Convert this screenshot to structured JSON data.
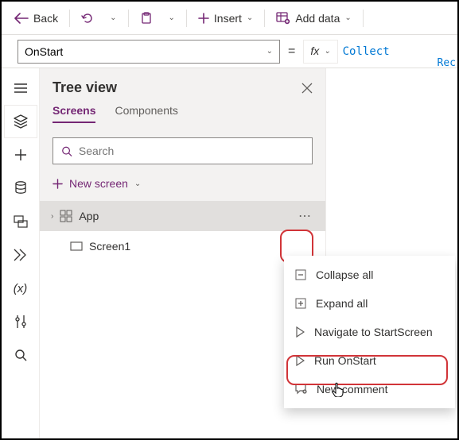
{
  "topbar": {
    "back": "Back",
    "insert": "Insert",
    "add_data": "Add data"
  },
  "formula": {
    "property": "OnStart",
    "fx": "fx",
    "text1": "Collect",
    "text2": "Rec"
  },
  "rail": {},
  "tree": {
    "title": "Tree view",
    "tabs": {
      "screens": "Screens",
      "components": "Components"
    },
    "search_placeholder": "Search",
    "new_screen": "New screen",
    "nodes": {
      "app": "App",
      "screen1": "Screen1"
    }
  },
  "menu": {
    "collapse": "Collapse all",
    "expand": "Expand all",
    "navigate": "Navigate to StartScreen",
    "run": "Run OnStart",
    "comment": "New comment"
  }
}
